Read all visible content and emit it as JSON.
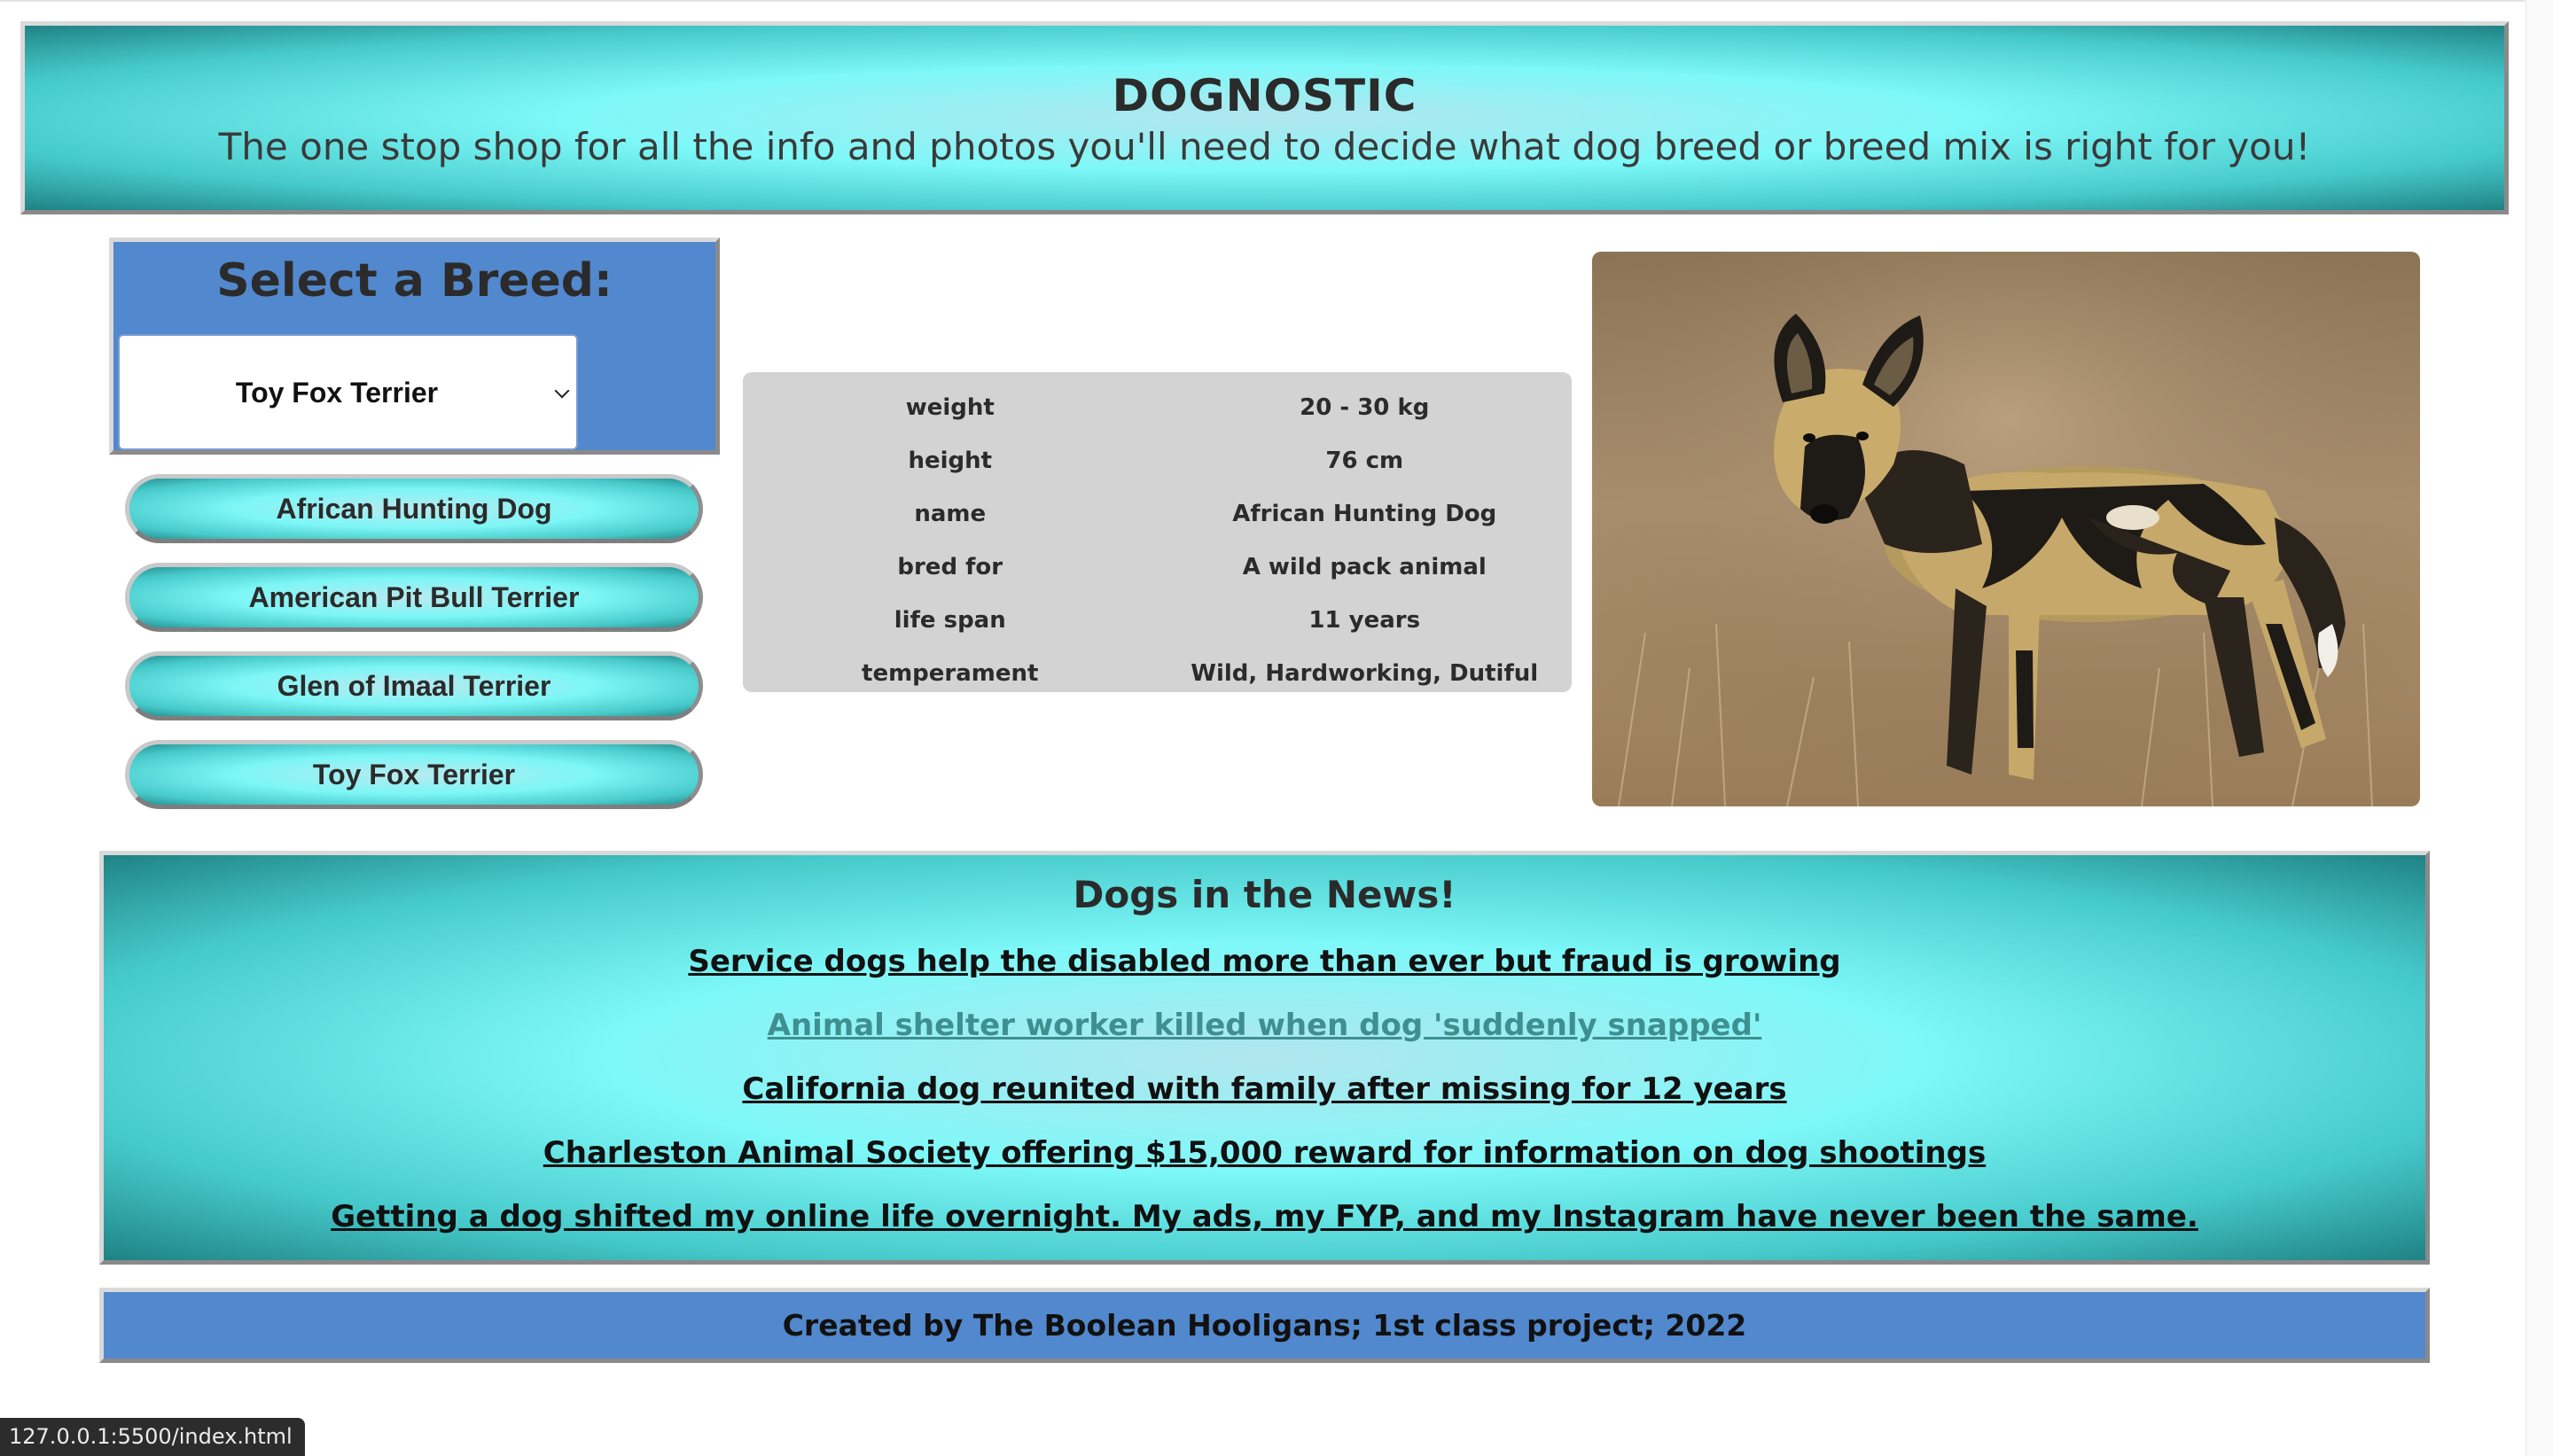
{
  "header": {
    "title": "DOGNOSTIC",
    "tagline": "The one stop shop for all the info and photos you'll need to decide what dog breed or breed mix is right for you!"
  },
  "selector": {
    "title": "Select a Breed:",
    "selected_value": "Toy Fox Terrier",
    "icon": "chevron-down-icon"
  },
  "breed_buttons": [
    "African Hunting Dog",
    "American Pit Bull Terrier",
    "Glen of Imaal Terrier",
    "Toy Fox Terrier"
  ],
  "info_table": [
    {
      "key": "weight",
      "value": "20 - 30 kg"
    },
    {
      "key": "height",
      "value": "76 cm"
    },
    {
      "key": "name",
      "value": "African Hunting Dog"
    },
    {
      "key": "bred for",
      "value": "A wild pack animal"
    },
    {
      "key": "life span",
      "value": "11 years"
    },
    {
      "key": "temperament",
      "value": "Wild, Hardworking, Dutiful"
    }
  ],
  "news": {
    "title": "Dogs in the News!",
    "links": [
      {
        "text": "Service dogs help the disabled more than ever but fraud is growing",
        "visited": false
      },
      {
        "text": "Animal shelter worker killed when dog 'suddenly snapped'",
        "visited": true
      },
      {
        "text": "California dog reunited with family after missing for 12 years",
        "visited": false
      },
      {
        "text": "Charleston Animal Society offering $15,000 reward for information on dog shootings",
        "visited": false
      },
      {
        "text": "Getting a dog shifted my online life overnight. My ads, my FYP, and my Instagram have never been the same.",
        "visited": false
      }
    ]
  },
  "footer": {
    "text": "Created by The Boolean Hooligans; 1st class project; 2022"
  },
  "status_bar": {
    "url": "127.0.0.1:5500/index.html"
  },
  "colors": {
    "aqua": "#7ef8f8",
    "teal_dark": "#1f8284",
    "panel_blue": "#5288cd",
    "table_gray": "#d3d3d3",
    "visited_link": "#3f8f90"
  }
}
